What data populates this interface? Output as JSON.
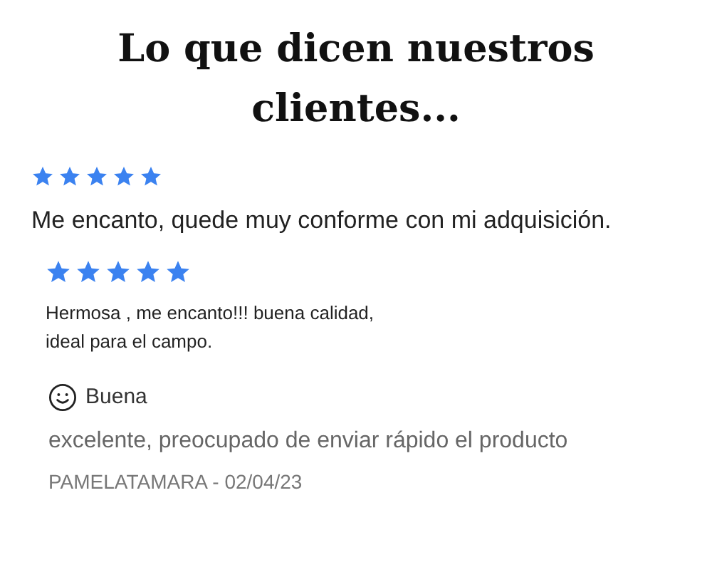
{
  "title": "Lo que dicen nuestros clientes...",
  "reviews": [
    {
      "kind": "stars",
      "stars": 5,
      "text": "Me encanto, quede muy conforme con mi adquisición."
    },
    {
      "kind": "stars",
      "stars": 5,
      "text": "Hermosa , me encanto!!! buena calidad,\nideal para el campo."
    },
    {
      "kind": "label",
      "label": "Buena",
      "text": "excelente, preocupado de enviar rápido el producto",
      "author": "PAMELATAMARA - 02/04/23"
    }
  ]
}
